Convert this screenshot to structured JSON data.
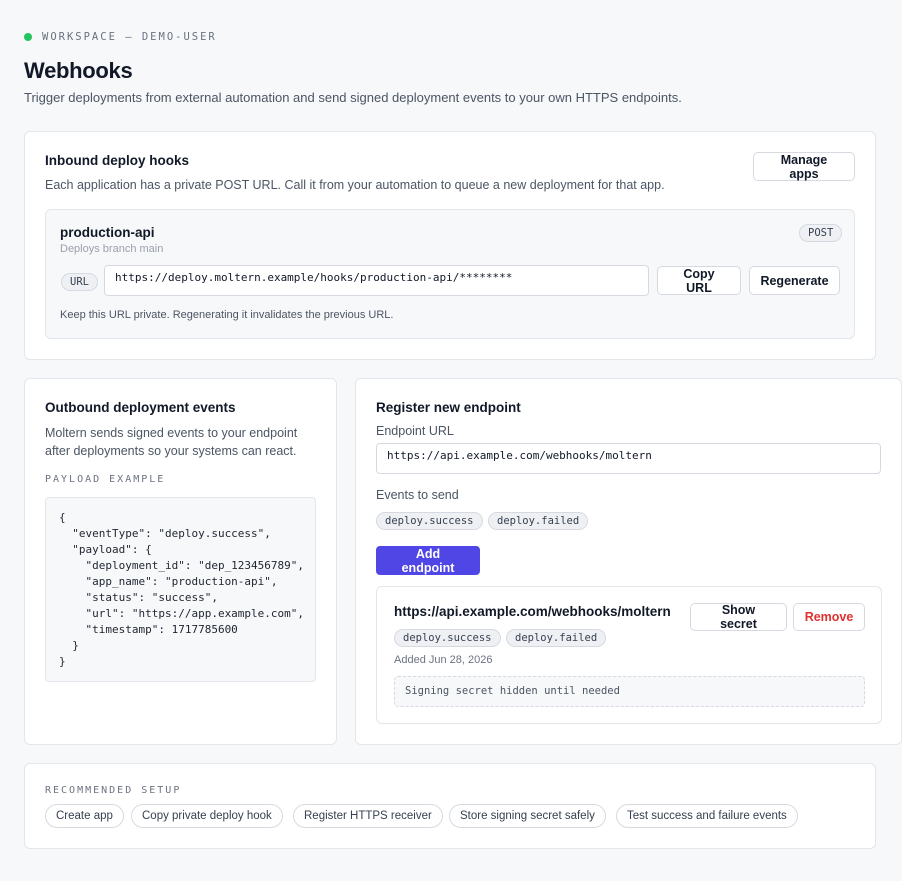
{
  "workspace": {
    "label": "WORKSPACE – DEMO-USER",
    "status_color": "#22c55e"
  },
  "page": {
    "title": "Webhooks",
    "subtitle": "Trigger deployments from external automation and send signed deployment events to your own HTTPS endpoints."
  },
  "inbound": {
    "title": "Inbound deploy hooks",
    "description": "Each application has a private POST URL. Call it from your automation to queue a new deployment for that app.",
    "manage_label": "Manage apps",
    "hook": {
      "app_name": "production-api",
      "branch_text": "Deploys branch main",
      "method": "POST",
      "url_tag": "URL",
      "url": "https://deploy.moltern.example/hooks/production-api/********",
      "copy_label": "Copy URL",
      "regenerate_label": "Regenerate",
      "note": "Keep this URL private. Regenerating it invalidates the previous URL."
    }
  },
  "outbound": {
    "title": "Outbound deployment events",
    "description": "Moltern sends signed events to your endpoint after deployments so your systems can react.",
    "payload_label": "PAYLOAD EXAMPLE",
    "payload": "{\n  \"eventType\": \"deploy.success\",\n  \"payload\": {\n    \"deployment_id\": \"dep_123456789\",\n    \"app_name\": \"production-api\",\n    \"status\": \"success\",\n    \"url\": \"https://app.example.com\",\n    \"timestamp\": 1717785600\n  }\n}"
  },
  "register": {
    "title": "Register new endpoint",
    "url_label": "Endpoint URL",
    "url_value": "https://api.example.com/webhooks/moltern",
    "events_label": "Events to send",
    "events": [
      "deploy.success",
      "deploy.failed"
    ],
    "add_label": "Add endpoint",
    "accent_color": "#4f46e5",
    "endpoint": {
      "url": "https://api.example.com/webhooks/moltern",
      "events": [
        "deploy.success",
        "deploy.failed"
      ],
      "added": "Added Jun 28, 2026",
      "show_secret_label": "Show secret",
      "remove_label": "Remove",
      "secret_placeholder": "Signing secret hidden until needed",
      "danger_color": "#e03131"
    }
  },
  "setup": {
    "label": "RECOMMENDED SETUP",
    "steps": [
      "Create app",
      "Copy private deploy hook",
      "Register HTTPS receiver",
      "Store signing secret safely",
      "Test success and failure events"
    ]
  }
}
